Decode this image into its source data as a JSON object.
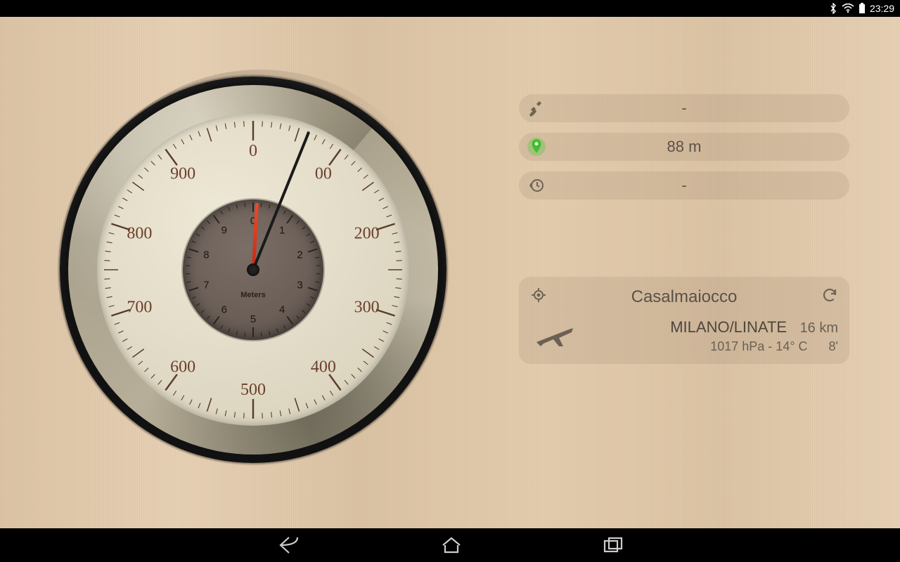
{
  "status": {
    "time": "23:29"
  },
  "gauge": {
    "unit": "Meters",
    "outer_numbers": [
      "0",
      "00",
      "200",
      "300",
      "400",
      "500",
      "600",
      "700",
      "800",
      "900"
    ],
    "inner_numbers": [
      "0",
      "1",
      "2",
      "3",
      "4",
      "5",
      "6",
      "7",
      "8",
      "9"
    ],
    "main_needle_deg": 22,
    "red_needle_deg": 3
  },
  "readouts": {
    "gps": "-",
    "location": "88 m",
    "history": "-"
  },
  "card": {
    "place": "Casalmaiocco",
    "station": "MILANO/LINATE",
    "distance": "16 km",
    "pressure_temp": "1017 hPa - 14° C",
    "age": "8'"
  }
}
